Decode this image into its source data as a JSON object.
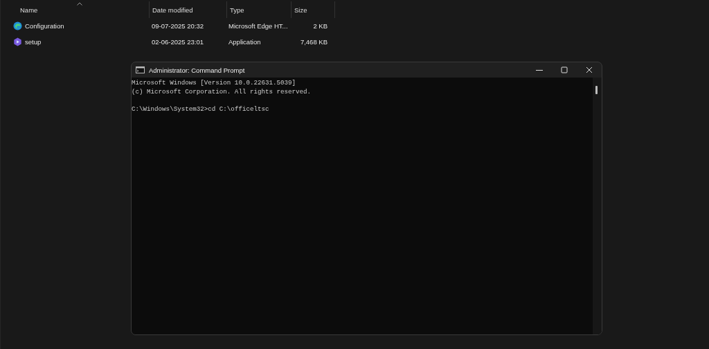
{
  "explorer": {
    "columns": [
      {
        "label": "Name",
        "sorted": true
      },
      {
        "label": "Date modified",
        "sorted": false
      },
      {
        "label": "Type",
        "sorted": false
      },
      {
        "label": "Size",
        "sorted": false
      }
    ],
    "files": [
      {
        "name": "Configuration",
        "kind": "edge",
        "date": "09-07-2025 20:32",
        "type": "Microsoft Edge HT...",
        "size": "2 KB"
      },
      {
        "name": "setup",
        "kind": "app",
        "date": "02-06-2025 23:01",
        "type": "Application",
        "size": "7,468 KB"
      }
    ]
  },
  "console": {
    "title": "Administrator: Command Prompt",
    "output": [
      "Microsoft Windows [Version 10.0.22631.5039]",
      "(c) Microsoft Corporation. All rights reserved."
    ],
    "prompt": "C:\\Windows\\System32>",
    "command": "cd C:\\officeltsc"
  }
}
